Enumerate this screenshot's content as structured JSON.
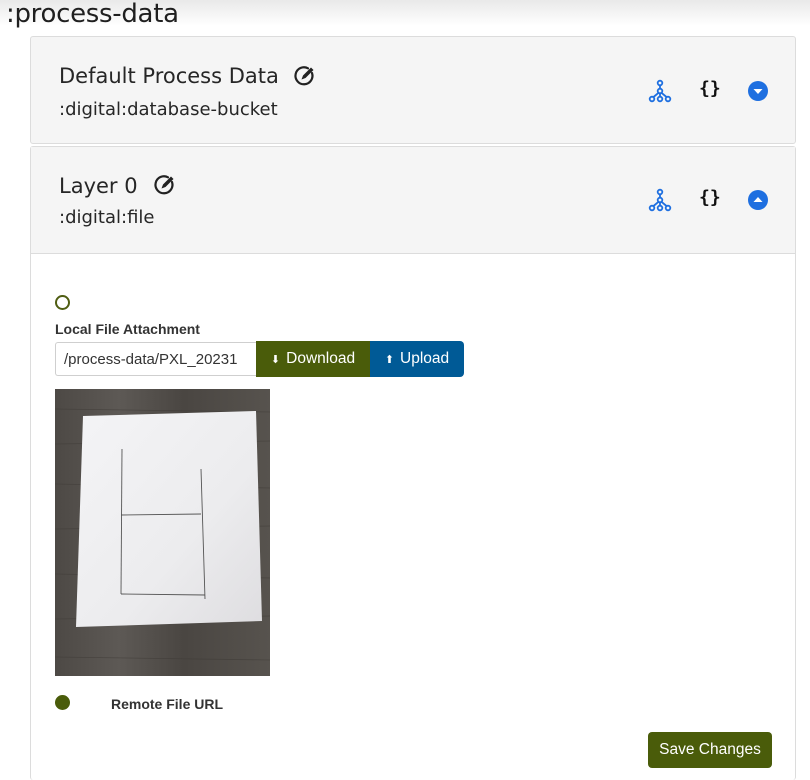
{
  "page": {
    "title": ":process-data"
  },
  "cards": [
    {
      "title": "Default Process Data",
      "subtitle": ":digital:database-bucket",
      "expanded": false
    },
    {
      "title": "Layer 0",
      "subtitle": ":digital:file",
      "expanded": true
    }
  ],
  "icons": {
    "edit": "edit-pencil-circle-icon",
    "tree": "hierarchy-tree-icon",
    "json": "{}",
    "expand": "chevron-down-circle-icon",
    "collapse": "chevron-up-circle-icon"
  },
  "file_section": {
    "local_label": "Local File Attachment",
    "file_path": "/process-data/PXL_20231",
    "download_label": "Download",
    "upload_label": "Upload",
    "remote_label": "Remote File URL",
    "local_selected": false,
    "remote_selected": true
  },
  "actions": {
    "save_label": "Save Changes"
  },
  "colors": {
    "accent_green": "#4a5c0a",
    "upload_blue": "#005a96",
    "icon_blue": "#1e6fe0"
  }
}
